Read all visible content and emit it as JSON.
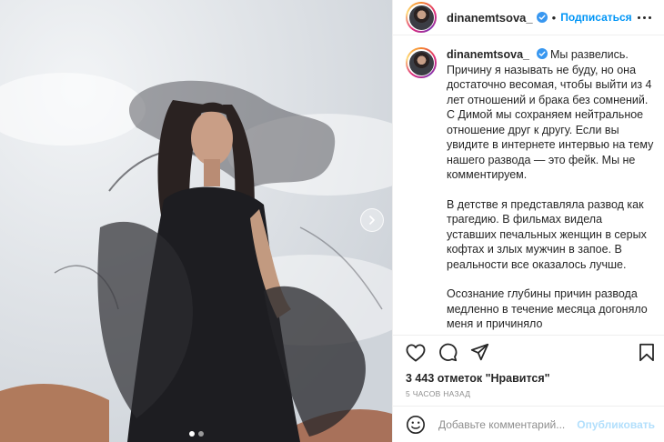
{
  "post": {
    "carousel": {
      "slide_count": 2,
      "active_slide": 1
    }
  },
  "header": {
    "username": "dinanemtsova_",
    "separator": "•",
    "follow_label": "Подписаться"
  },
  "caption": {
    "username": "dinanemtsova_",
    "paragraphs": [
      "Мы развелись. Причину я называть не буду, но она достаточно весомая, чтобы выйти из 4 лет отношений и брака без сомнений. С Димой мы сохраняем нейтральное отношение друг к другу. Если вы увидите в интернете интервью на тему нашего развода — это фейк. Мы не комментируем.",
      "В детстве я представляла развод как трагедию. В фильмах видела уставших печальных женщин в серых кофтах и злых мужчин в запое. В реальности все оказалось лучше.",
      "Осознание глубины причин развода медленно в течение месяца догоняло меня и причиняло"
    ]
  },
  "actions": {
    "icons": [
      "heart-icon",
      "comment-icon",
      "share-icon",
      "bookmark-icon"
    ]
  },
  "likes": {
    "count": "3 443",
    "label": "отметок \"Нравится\""
  },
  "timestamp": "5 ЧАСОВ НАЗАД",
  "comment": {
    "placeholder": "Добавьте комментарий...",
    "publish_label": "Опубликовать"
  },
  "colors": {
    "accent": "#0095f6",
    "publish_disabled": "#b2dffc",
    "muted": "#8e8e8e",
    "text": "#262626"
  }
}
